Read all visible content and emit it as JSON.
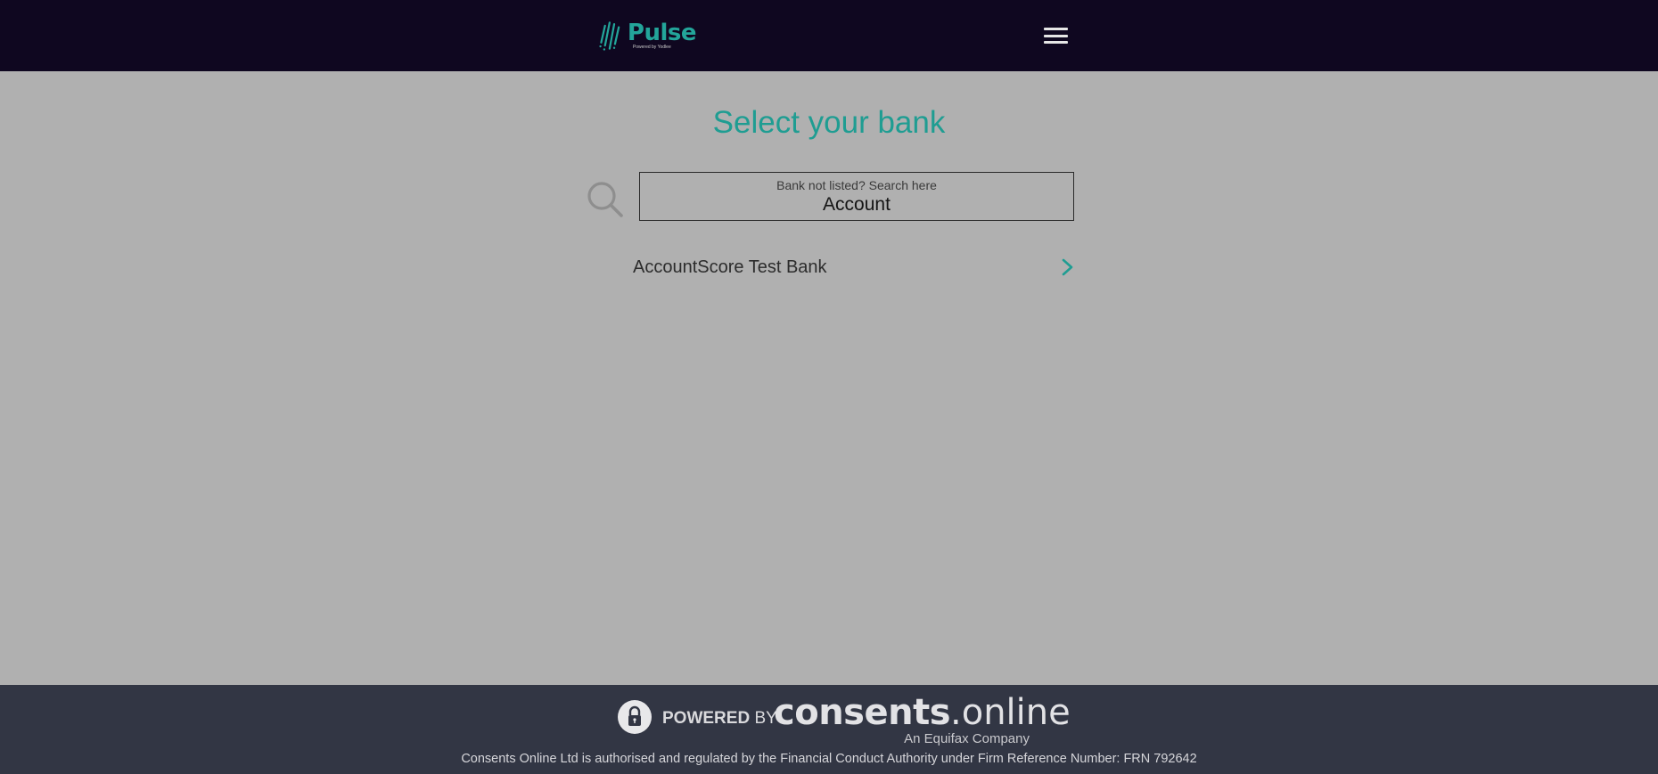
{
  "header": {
    "logo_text": "Pulse",
    "logo_subtext": "Powered by Yodlee",
    "menu_icon": "hamburger-menu-icon"
  },
  "main": {
    "title": "Select your bank",
    "search": {
      "label": "Bank not listed? Search here",
      "value": "Account",
      "icon": "search-icon"
    },
    "banks": [
      {
        "name": "AccountScore Test Bank",
        "icon": "chevron-right-icon"
      }
    ]
  },
  "footer": {
    "powered_prefix": "POWERED",
    "powered_by": "BY",
    "brand_bold": "consents",
    "brand_light": ".online",
    "brand_tagline": "An Equifax Company",
    "regulatory_text": "Consents Online Ltd is authorised and regulated by the Financial Conduct Authority under Firm Reference Number: FRN 792642",
    "lock_icon": "lock-icon"
  },
  "colors": {
    "header_bg": "#0f0720",
    "page_bg": "#b0b0b0",
    "accent": "#1f9d92",
    "footer_bg": "#323644"
  }
}
